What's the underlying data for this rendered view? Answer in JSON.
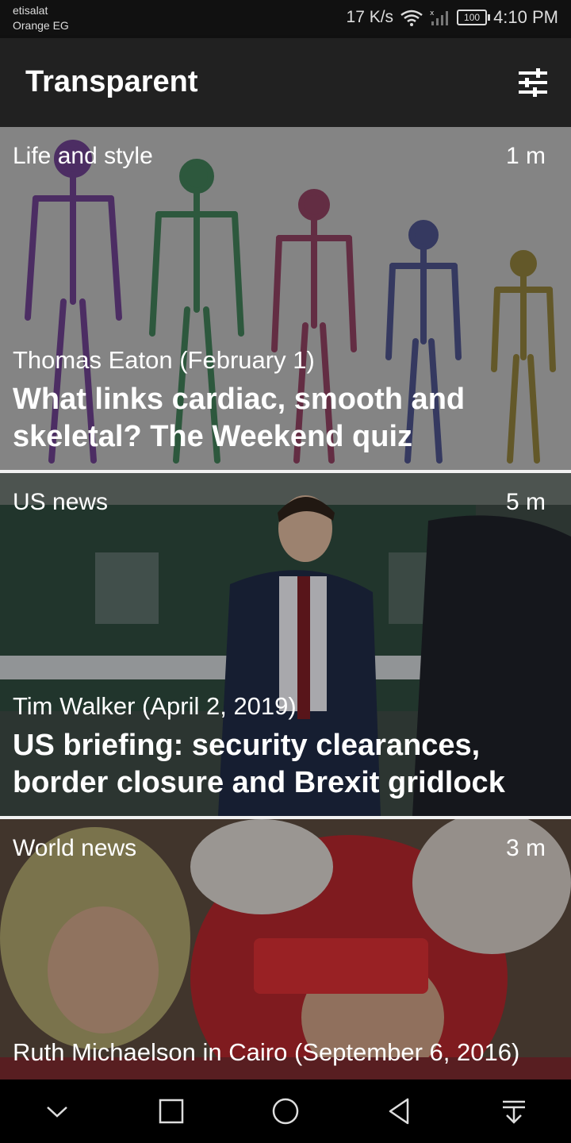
{
  "status_bar": {
    "carrier_line1": "etisalat",
    "carrier_line2": "Orange EG",
    "net_speed": "17 K/s",
    "battery": "100",
    "time": "4:10 PM"
  },
  "app_bar": {
    "title": "Transparent",
    "filter_icon": "tune-icon"
  },
  "cards": [
    {
      "category": "Life and style",
      "age": "1 m",
      "byline": "Thomas Eaton (February 1)",
      "headline": "What links cardiac, smooth and skeletal? The Weekend quiz"
    },
    {
      "category": "US news",
      "age": "5 m",
      "byline": "Tim Walker (April 2, 2019)",
      "headline": "US briefing: security clearances, border closure and Brexit gridlock"
    },
    {
      "category": "World news",
      "age": "3 m",
      "byline": "Ruth Michaelson in Cairo (September 6, 2016)",
      "headline": ""
    }
  ],
  "nav_bar": {
    "icons": [
      "chevron-down-icon",
      "recent-apps-icon",
      "home-icon",
      "back-icon",
      "notification-pull-icon"
    ]
  },
  "colors": {
    "app_bar": "#212121",
    "status_bar": "#111111",
    "divider": "#f2f2f2"
  }
}
